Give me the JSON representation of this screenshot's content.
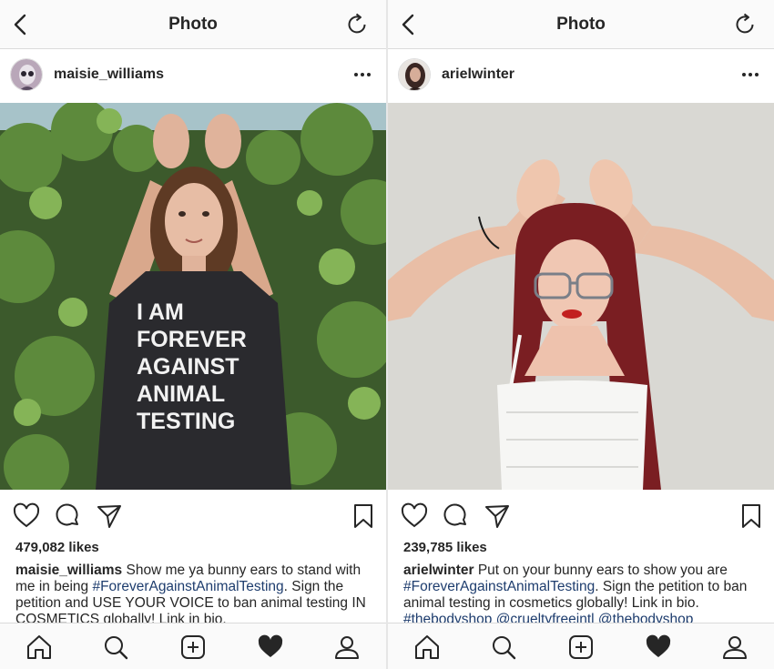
{
  "panels": [
    {
      "nav_title": "Photo",
      "username": "maisie_williams",
      "photo_shirt_lines": [
        "I AM",
        "FOREVER",
        "AGAINST",
        "ANIMAL",
        "TESTING"
      ],
      "likes": "479,082 likes",
      "caption": {
        "username": "maisie_williams",
        "text_1": " Show me ya bunny ears to stand with me in being ",
        "hashtag_1": "#ForeverAgainstAnimalTesting",
        "text_2": ". Sign the petition and USE YOUR VOICE to ban animal testing IN COSMETICS globally! Link in bio."
      }
    },
    {
      "nav_title": "Photo",
      "username": "arielwinter",
      "likes": "239,785 likes",
      "caption": {
        "username": "arielwinter",
        "text_1": " Put on your bunny ears to show you are ",
        "hashtag_1": "#ForeverAgainstAnimalTesting",
        "text_2": ". Sign the petition to ban animal testing in cosmetics globally! Link in bio. ",
        "hashtag_2": "#thebodyshop @crueltyfreeintl @thebodyshop"
      }
    }
  ],
  "icons": {
    "nav": [
      "back-icon",
      "refresh-icon"
    ],
    "post": [
      "more-icon"
    ],
    "actions": [
      "heart-icon",
      "comment-icon",
      "share-icon",
      "bookmark-icon"
    ],
    "tabs": [
      "home-icon",
      "search-icon",
      "new-post-icon",
      "activity-heart-icon",
      "profile-icon"
    ]
  },
  "colors": {
    "text": "#262626",
    "hashtag": "#1e3d6e",
    "border": "#dbdbdb",
    "bar_bg": "#fafafa"
  }
}
